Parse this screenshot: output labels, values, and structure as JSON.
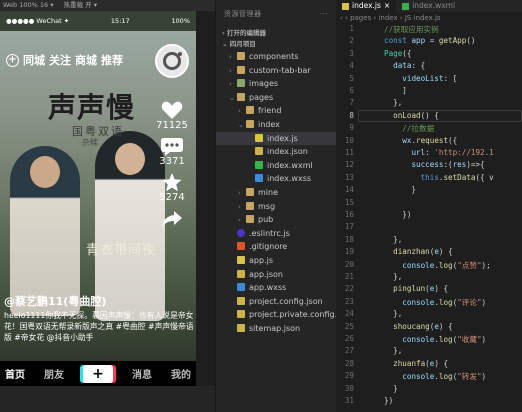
{
  "top_strip": {
    "left": "Web 100% 16 ▾",
    "mid": "热重载 开 ▾"
  },
  "phone": {
    "status_bar": {
      "left": "●●●●● WeChat ✦",
      "time": "15:17",
      "battery": "100%"
    },
    "top_nav": [
      "同城",
      "关注",
      "商城",
      "推荐"
    ],
    "poster": {
      "title": "声声慢",
      "subtitle": "国粤双语",
      "subtitle2": "杂糅",
      "sign": "青衣带间夜"
    },
    "actions": {
      "likes": "71125",
      "comments": "3371",
      "favorites": "5274"
    },
    "caption": {
      "user": "@蔡艺鹏11(粤曲腔)",
      "desc": "heelo1111你我不无探。暮因声声慢：也有人说是帝女花！国粤双语无帮录新版声之真 #粤曲腔 #声声慢帝语版 #帝女花 @抖音小助手"
    },
    "tab_bar": [
      "首页",
      "朋友",
      "+",
      "消息",
      "我的"
    ]
  },
  "explorer": {
    "title": "资源管理器",
    "section_open": "打开的编辑器",
    "section_project": "四月项目",
    "tree": [
      {
        "label": "components",
        "indent": 1,
        "kind": "folder",
        "open": false
      },
      {
        "label": "custom-tab-bar",
        "indent": 1,
        "kind": "folder",
        "open": false
      },
      {
        "label": "images",
        "indent": 1,
        "kind": "folder-green",
        "open": false
      },
      {
        "label": "pages",
        "indent": 1,
        "kind": "folder",
        "open": true
      },
      {
        "label": "friend",
        "indent": 2,
        "kind": "folder",
        "open": false
      },
      {
        "label": "index",
        "indent": 2,
        "kind": "folder",
        "open": true
      },
      {
        "label": "index.js",
        "indent": 3,
        "kind": "js",
        "selected": true
      },
      {
        "label": "index.json",
        "indent": 3,
        "kind": "json"
      },
      {
        "label": "index.wxml",
        "indent": 3,
        "kind": "wxml"
      },
      {
        "label": "index.wxss",
        "indent": 3,
        "kind": "wxss"
      },
      {
        "label": "mine",
        "indent": 2,
        "kind": "folder",
        "open": false
      },
      {
        "label": "msg",
        "indent": 2,
        "kind": "folder",
        "open": false
      },
      {
        "label": "pub",
        "indent": 2,
        "kind": "folder",
        "open": false
      },
      {
        "label": ".eslintrc.js",
        "indent": 1,
        "kind": "eslint"
      },
      {
        "label": ".gitignore",
        "indent": 1,
        "kind": "git"
      },
      {
        "label": "app.js",
        "indent": 1,
        "kind": "js"
      },
      {
        "label": "app.json",
        "indent": 1,
        "kind": "json"
      },
      {
        "label": "app.wxss",
        "indent": 1,
        "kind": "wxss"
      },
      {
        "label": "project.config.json",
        "indent": 1,
        "kind": "json"
      },
      {
        "label": "project.private.config.js...",
        "indent": 1,
        "kind": "json"
      },
      {
        "label": "sitemap.json",
        "indent": 1,
        "kind": "json"
      }
    ]
  },
  "editor": {
    "tabs": [
      "index.js",
      "index.wxml"
    ],
    "breadcrumb": "pages › index › JS index.js",
    "lines": [
      {
        "n": "1",
        "code": "//获取应用实例"
      },
      {
        "n": "2",
        "code": "const app = getApp()"
      },
      {
        "n": "3",
        "code": "Page({"
      },
      {
        "n": "4",
        "code": "  data: {"
      },
      {
        "n": "5",
        "code": "    videoList: ["
      },
      {
        "n": "6",
        "code": "    ]"
      },
      {
        "n": "7",
        "code": "  },"
      },
      {
        "n": "8",
        "code": "  onLoad() {"
      },
      {
        "n": "9",
        "code": "    //拉数据"
      },
      {
        "n": "10",
        "code": "    wx.request({"
      },
      {
        "n": "11",
        "code": "      url: 'http://192.1"
      },
      {
        "n": "12",
        "code": "      success:(res)=>{"
      },
      {
        "n": "13",
        "code": "        this.setData({ v"
      },
      {
        "n": "14",
        "code": "      }"
      },
      {
        "n": "15",
        "code": ""
      },
      {
        "n": "16",
        "code": "    })"
      },
      {
        "n": "17",
        "code": ""
      },
      {
        "n": "18",
        "code": "  },"
      },
      {
        "n": "19",
        "code": "  dianzhan(e) {"
      },
      {
        "n": "20",
        "code": "    console.log(\"点赞\");"
      },
      {
        "n": "21",
        "code": "  },"
      },
      {
        "n": "22",
        "code": "  pinglun(e) {"
      },
      {
        "n": "23",
        "code": "    console.log(\"评论\")"
      },
      {
        "n": "24",
        "code": "  },"
      },
      {
        "n": "25",
        "code": "  shoucang(e) {"
      },
      {
        "n": "26",
        "code": "    console.log(\"收藏\")"
      },
      {
        "n": "27",
        "code": "  },"
      },
      {
        "n": "28",
        "code": "  zhuanfa(e) {"
      },
      {
        "n": "29",
        "code": "    console.log(\"转发\")"
      },
      {
        "n": "30",
        "code": "  }"
      },
      {
        "n": "31",
        "code": "})"
      }
    ]
  }
}
